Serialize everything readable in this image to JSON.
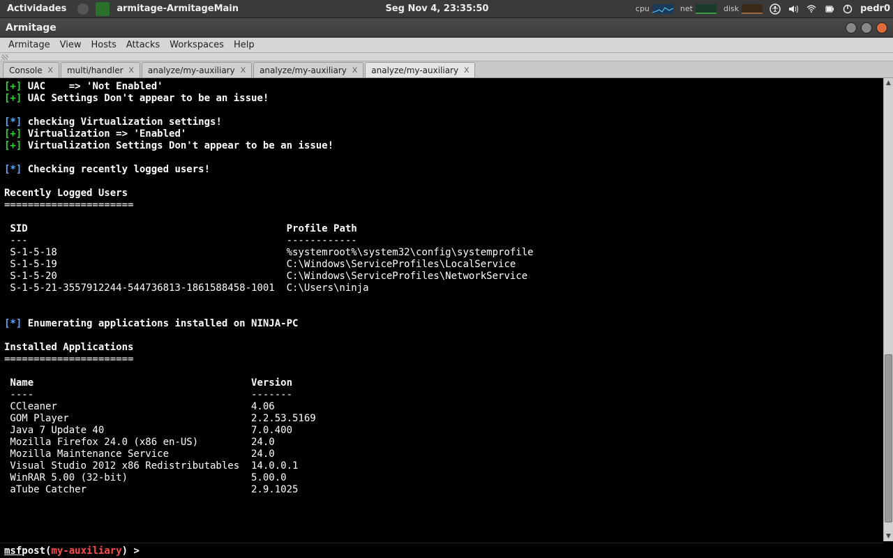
{
  "topbar": {
    "activities": "Actividades",
    "app_title": "armitage-ArmitageMain",
    "clock": "Seg Nov  4, 23:35:50",
    "stats": {
      "cpu": "cpu",
      "net": "net",
      "disk": "disk"
    },
    "user": "pedr0"
  },
  "window": {
    "title": "Armitage"
  },
  "menus": {
    "armitage": "Armitage",
    "view": "View",
    "hosts": "Hosts",
    "attacks": "Attacks",
    "workspaces": "Workspaces",
    "help": "Help"
  },
  "tabs": [
    {
      "label": "Console",
      "active": false
    },
    {
      "label": "multi/handler",
      "active": false
    },
    {
      "label": "analyze/my-auxiliary",
      "active": false
    },
    {
      "label": "analyze/my-auxiliary",
      "active": false
    },
    {
      "label": "analyze/my-auxiliary",
      "active": true
    }
  ],
  "console_lines": [
    {
      "sig": "+",
      "text": "UAC    => 'Not Enabled'"
    },
    {
      "sig": "+",
      "text": "UAC Settings Don't appear to be an issue!"
    },
    {
      "sig": "",
      "text": ""
    },
    {
      "sig": "*",
      "text": "checking Virtualization settings!"
    },
    {
      "sig": "+",
      "text": "Virtualization => 'Enabled'"
    },
    {
      "sig": "+",
      "text": "Virtualization Settings Don't appear to be an issue!"
    },
    {
      "sig": "",
      "text": ""
    },
    {
      "sig": "*",
      "text": "Checking recently logged users!"
    },
    {
      "sig": "",
      "text": ""
    }
  ],
  "users_table": {
    "title": "Recently Logged Users",
    "rule": "======================",
    "col1_header": "SID",
    "col2_header": "Profile Path",
    "col1_dash": "---",
    "col2_dash": "------------",
    "rows": [
      {
        "sid": "S-1-5-18",
        "path": "%systemroot%\\system32\\config\\systemprofile"
      },
      {
        "sid": "S-1-5-19",
        "path": "C:\\Windows\\ServiceProfiles\\LocalService"
      },
      {
        "sid": "S-1-5-20",
        "path": "C:\\Windows\\ServiceProfiles\\NetworkService"
      },
      {
        "sid": "S-1-5-21-3557912244-544736813-1861588458-1001",
        "path": "C:\\Users\\ninja"
      }
    ]
  },
  "enum_line": "Enumerating applications installed on NINJA-PC",
  "apps_table": {
    "title": "Installed Applications",
    "rule": "======================",
    "col1_header": "Name",
    "col2_header": "Version",
    "col1_dash": "----",
    "col2_dash": "-------",
    "rows": [
      {
        "name": "CCleaner",
        "version": "4.06"
      },
      {
        "name": "GOM Player",
        "version": "2.2.53.5169"
      },
      {
        "name": "Java 7 Update 40",
        "version": "7.0.400"
      },
      {
        "name": "Mozilla Firefox 24.0 (x86 en-US)",
        "version": "24.0"
      },
      {
        "name": "Mozilla Maintenance Service",
        "version": "24.0"
      },
      {
        "name": "Visual Studio 2012 x86 Redistributables",
        "version": "14.0.0.1"
      },
      {
        "name": "WinRAR 5.00 (32-bit)",
        "version": "5.00.0"
      },
      {
        "name": "aTube Catcher",
        "version": "2.9.1025"
      }
    ]
  },
  "prompt": {
    "msf": "msf",
    "pre": "  post(",
    "module": "my-auxiliary",
    "post": ") > "
  }
}
